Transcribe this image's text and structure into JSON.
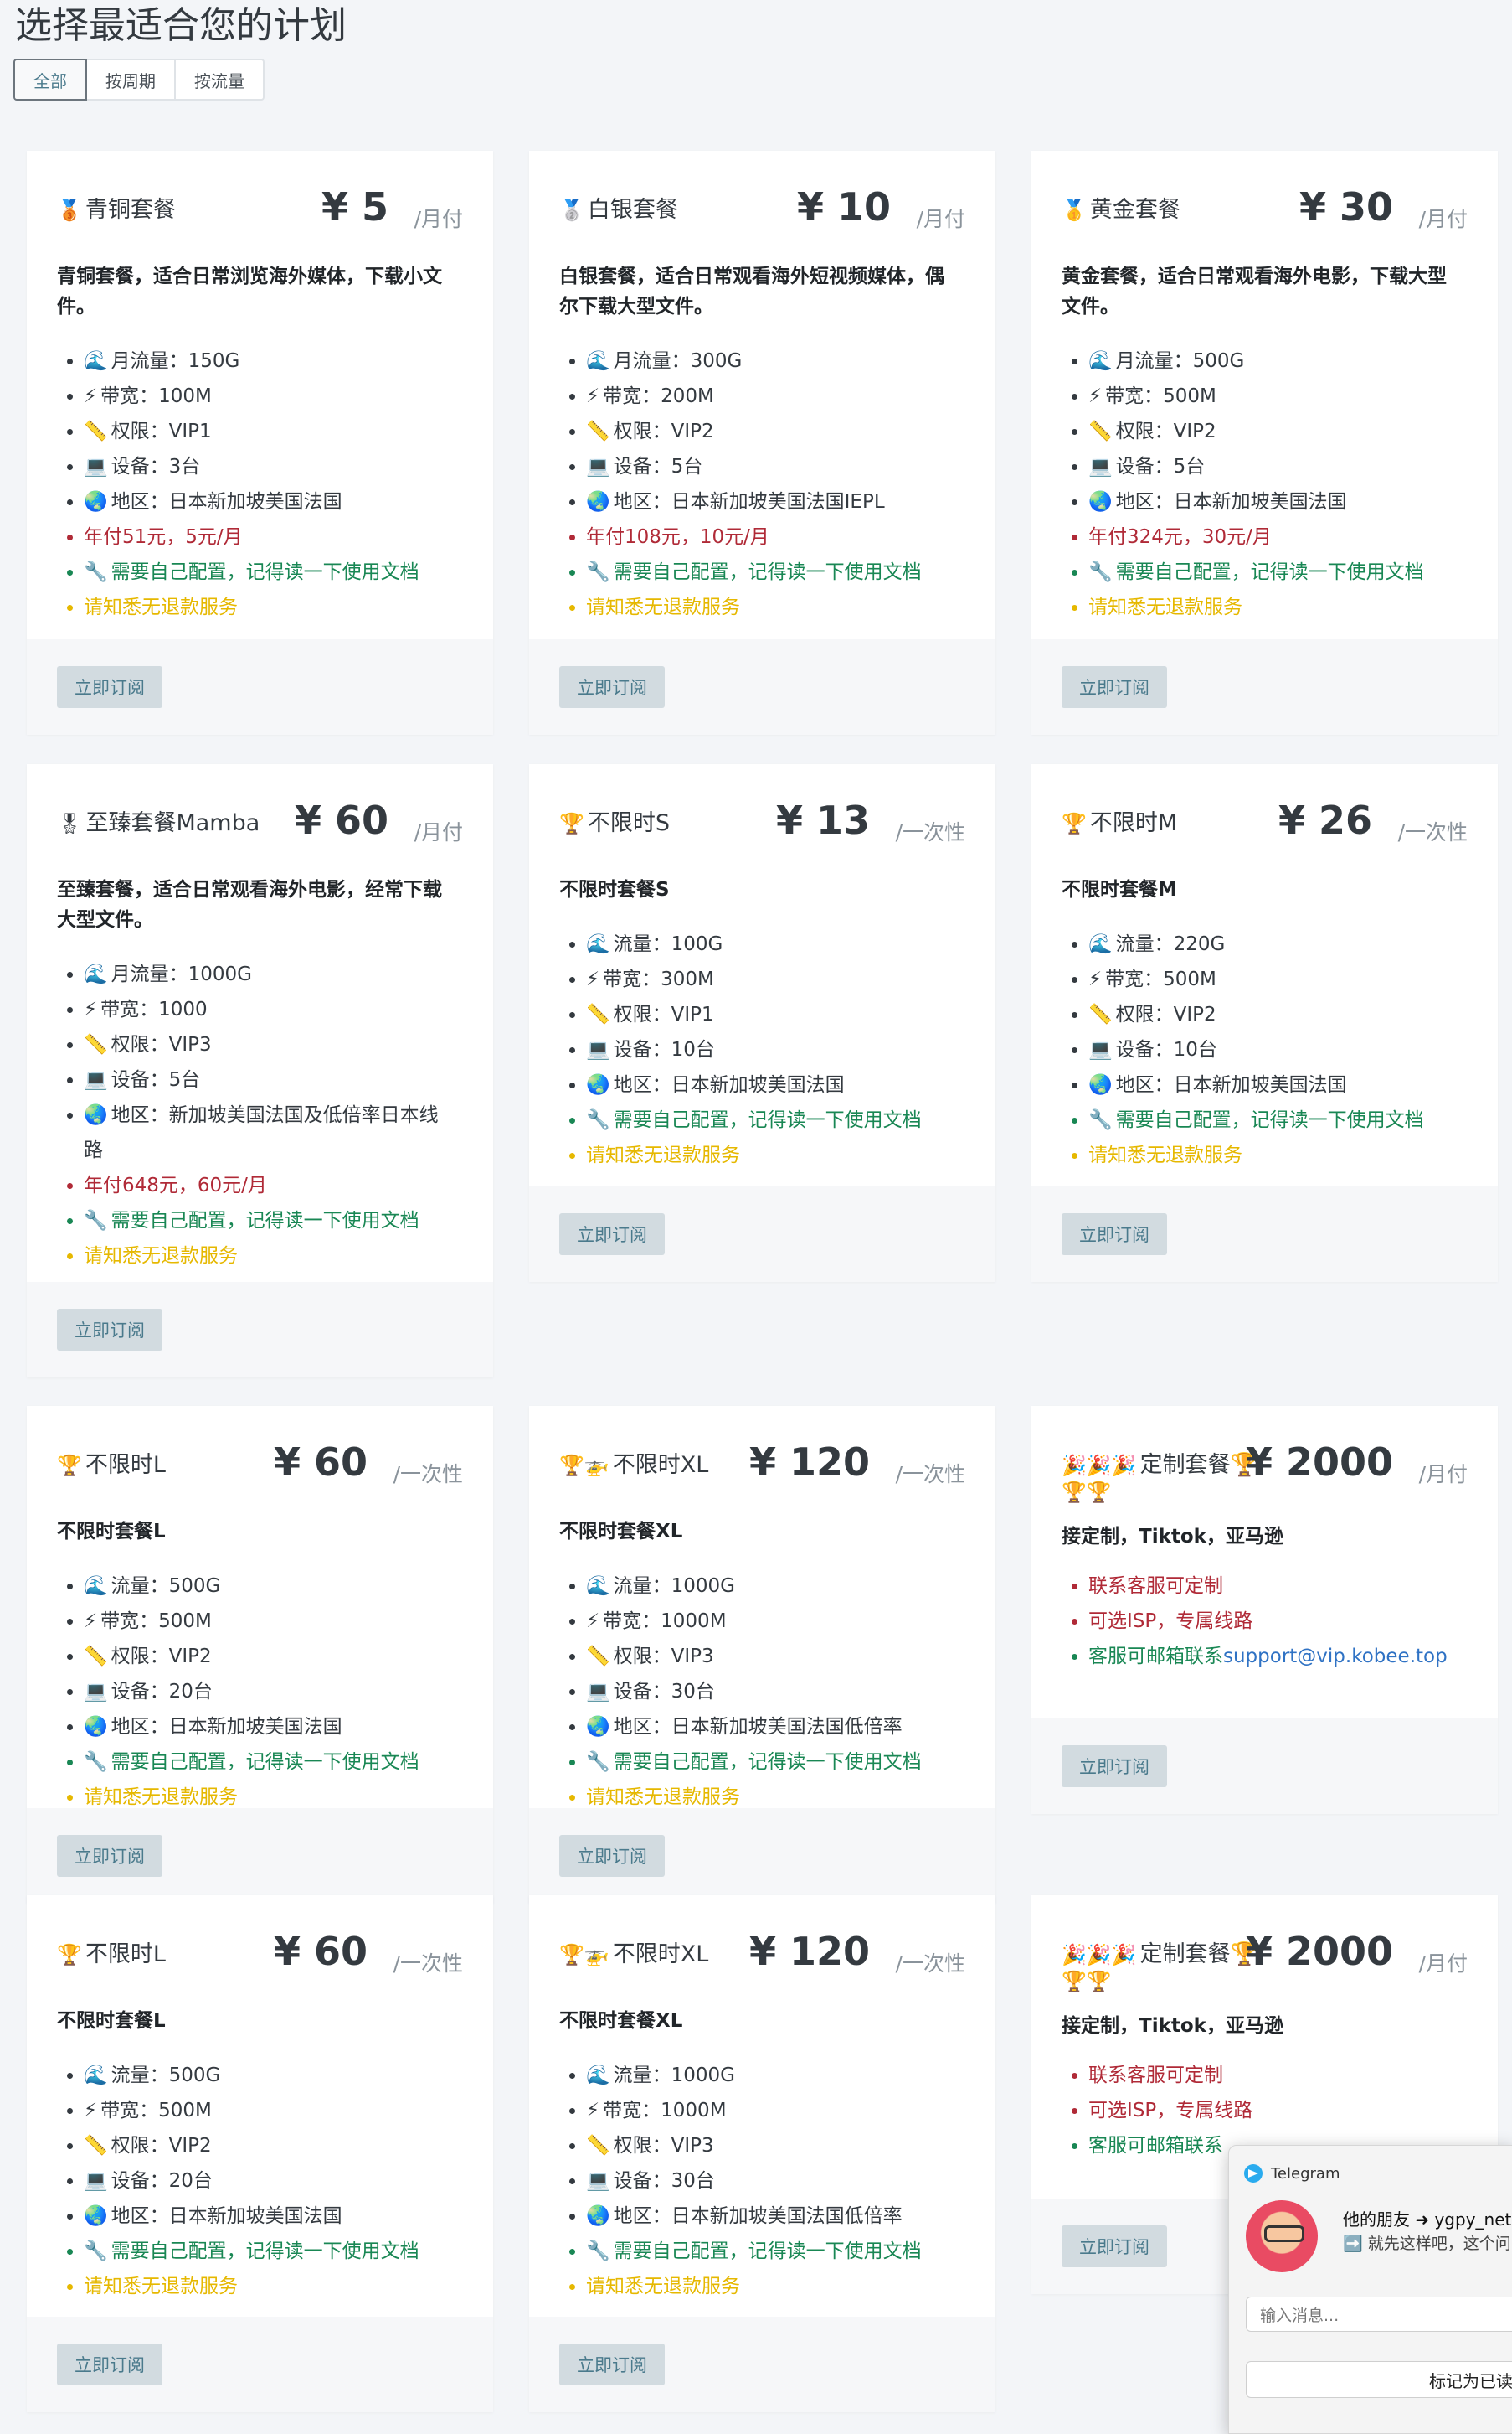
{
  "page": {
    "title": "选择最适合您的计划"
  },
  "filters": [
    {
      "label": "全部",
      "active": true
    },
    {
      "label": "按周期",
      "active": false
    },
    {
      "label": "按流量",
      "active": false
    }
  ],
  "subscribe_label": "立即订阅",
  "cards": [
    {
      "medal": "🥉",
      "name": "青铜套餐",
      "price": "¥ 5",
      "period": "/月付",
      "desc": [
        "青铜套餐，适合日常浏览海外媒体，下载小文",
        "件。"
      ],
      "features": [
        {
          "icon": "🌊",
          "text": "月流量：150G",
          "color": "default"
        },
        {
          "icon": "⚡",
          "text": "带宽：100M",
          "color": "default"
        },
        {
          "icon": "📏",
          "text": "权限：VIP1",
          "color": "default"
        },
        {
          "icon": "💻",
          "text": "设备：3台",
          "color": "default"
        },
        {
          "icon": "🌏",
          "text": "地区：日本新加坡美国法国",
          "color": "default"
        },
        {
          "icon": "",
          "text": "年付51元，5元/月",
          "color": "red"
        },
        {
          "icon": "🔧",
          "text": "需要自己配置，记得读一下使用文档",
          "color": "green"
        },
        {
          "icon": "",
          "text": "请知悉无退款服务",
          "color": "yellow"
        }
      ]
    },
    {
      "medal": "🥈",
      "name": "白银套餐",
      "price": "¥ 10",
      "period": "/月付",
      "desc": [
        "白银套餐，适合日常观看海外短视频媒体，偶",
        "尔下载大型文件。"
      ],
      "features": [
        {
          "icon": "🌊",
          "text": "月流量：300G",
          "color": "default"
        },
        {
          "icon": "⚡",
          "text": "带宽：200M",
          "color": "default"
        },
        {
          "icon": "📏",
          "text": "权限：VIP2",
          "color": "default"
        },
        {
          "icon": "💻",
          "text": "设备：5台",
          "color": "default"
        },
        {
          "icon": "🌏",
          "text": "地区：日本新加坡美国法国IEPL",
          "color": "default"
        },
        {
          "icon": "",
          "text": "年付108元，10元/月",
          "color": "red"
        },
        {
          "icon": "🔧",
          "text": "需要自己配置，记得读一下使用文档",
          "color": "green"
        },
        {
          "icon": "",
          "text": "请知悉无退款服务",
          "color": "yellow"
        }
      ]
    },
    {
      "medal": "🥇",
      "name": "黄金套餐",
      "price": "¥ 30",
      "period": "/月付",
      "desc": [
        "黄金套餐，适合日常观看海外电影，下载大型",
        "文件。"
      ],
      "features": [
        {
          "icon": "🌊",
          "text": "月流量：500G",
          "color": "default"
        },
        {
          "icon": "⚡",
          "text": "带宽：500M",
          "color": "default"
        },
        {
          "icon": "📏",
          "text": "权限：VIP2",
          "color": "default"
        },
        {
          "icon": "💻",
          "text": "设备：5台",
          "color": "default"
        },
        {
          "icon": "🌏",
          "text": "地区：日本新加坡美国法国",
          "color": "default"
        },
        {
          "icon": "",
          "text": "年付324元，30元/月",
          "color": "red"
        },
        {
          "icon": "🔧",
          "text": "需要自己配置，记得读一下使用文档",
          "color": "green"
        },
        {
          "icon": "",
          "text": "请知悉无退款服务",
          "color": "yellow"
        }
      ]
    },
    {
      "medal": "🎖",
      "name": "至臻套餐Mamba",
      "price": "¥ 60",
      "period": "/月付",
      "desc": [
        "至臻套餐，适合日常观看海外电影，经常下载",
        "大型文件。"
      ],
      "features": [
        {
          "icon": "🌊",
          "text": "月流量：1000G",
          "color": "default"
        },
        {
          "icon": "⚡",
          "text": "带宽：1000",
          "color": "default"
        },
        {
          "icon": "📏",
          "text": "权限：VIP3",
          "color": "default"
        },
        {
          "icon": "💻",
          "text": "设备：5台",
          "color": "default"
        },
        {
          "icon": "🌏",
          "text": "地区：新加坡美国法国及低倍率日本线",
          "text2": "路",
          "color": "default"
        },
        {
          "icon": "",
          "text": "年付648元，60元/月",
          "color": "red"
        },
        {
          "icon": "🔧",
          "text": "需要自己配置，记得读一下使用文档",
          "color": "green"
        },
        {
          "icon": "",
          "text": "请知悉无退款服务",
          "color": "yellow"
        }
      ]
    },
    {
      "medal": "🏆",
      "name": "不限时S",
      "price": "¥ 13",
      "period": "/一次性",
      "desc": [
        "不限时套餐S"
      ],
      "features": [
        {
          "icon": "🌊",
          "text": "流量：100G",
          "color": "default"
        },
        {
          "icon": "⚡",
          "text": "带宽：300M",
          "color": "default"
        },
        {
          "icon": "📏",
          "text": "权限：VIP1",
          "color": "default"
        },
        {
          "icon": "💻",
          "text": "设备：10台",
          "color": "default"
        },
        {
          "icon": "🌏",
          "text": "地区：日本新加坡美国法国",
          "color": "default"
        },
        {
          "icon": "🔧",
          "text": "需要自己配置，记得读一下使用文档",
          "color": "green"
        },
        {
          "icon": "",
          "text": "请知悉无退款服务",
          "color": "yellow"
        }
      ]
    },
    {
      "medal": "🏆",
      "name": "不限时M",
      "price": "¥ 26",
      "period": "/一次性",
      "desc": [
        "不限时套餐M"
      ],
      "features": [
        {
          "icon": "🌊",
          "text": "流量：220G",
          "color": "default"
        },
        {
          "icon": "⚡",
          "text": "带宽：500M",
          "color": "default"
        },
        {
          "icon": "📏",
          "text": "权限：VIP2",
          "color": "default"
        },
        {
          "icon": "💻",
          "text": "设备：10台",
          "color": "default"
        },
        {
          "icon": "🌏",
          "text": "地区：日本新加坡美国法国",
          "color": "default"
        },
        {
          "icon": "🔧",
          "text": "需要自己配置，记得读一下使用文档",
          "color": "green"
        },
        {
          "icon": "",
          "text": "请知悉无退款服务",
          "color": "yellow"
        }
      ]
    },
    {
      "medal": "🏆",
      "name": "不限时L",
      "price": "¥ 60",
      "period": "/一次性",
      "desc": [
        "不限时套餐L"
      ],
      "features": [
        {
          "icon": "🌊",
          "text": "流量：500G",
          "color": "default"
        },
        {
          "icon": "⚡",
          "text": "带宽：500M",
          "color": "default"
        },
        {
          "icon": "📏",
          "text": "权限：VIP2",
          "color": "default"
        },
        {
          "icon": "💻",
          "text": "设备：20台",
          "color": "default"
        },
        {
          "icon": "🌏",
          "text": "地区：日本新加坡美国法国",
          "color": "default"
        },
        {
          "icon": "🔧",
          "text": "需要自己配置，记得读一下使用文档",
          "color": "green"
        },
        {
          "icon": "",
          "text": "请知悉无退款服务",
          "color": "yellow"
        }
      ]
    },
    {
      "medal": "🏆🚁",
      "name": "不限时XL",
      "price": "¥ 120",
      "period": "/一次性",
      "desc": [
        "不限时套餐XL"
      ],
      "features": [
        {
          "icon": "🌊",
          "text": "流量：1000G",
          "color": "default"
        },
        {
          "icon": "⚡",
          "text": "带宽：1000M",
          "color": "default"
        },
        {
          "icon": "📏",
          "text": "权限：VIP3",
          "color": "default"
        },
        {
          "icon": "💻",
          "text": "设备：30台",
          "color": "default"
        },
        {
          "icon": "🌏",
          "text": "地区：日本新加坡美国法国低倍率",
          "color": "default"
        },
        {
          "icon": "🔧",
          "text": "需要自己配置，记得读一下使用文档",
          "color": "green"
        },
        {
          "icon": "",
          "text": "请知悉无退款服务",
          "color": "yellow"
        }
      ]
    },
    {
      "medal": "🎉🎉🎉",
      "name": "定制套餐🏆",
      "name2": "🏆🏆",
      "price": "¥ 2000",
      "period": "/月付",
      "desc": [
        "接定制，Tiktok，亚马逊"
      ],
      "features": [
        {
          "icon": "",
          "text": "联系客服可定制",
          "color": "red"
        },
        {
          "icon": "",
          "text": "可选ISP，专属线路",
          "color": "red"
        },
        {
          "icon": "",
          "text": "客服可邮箱联系",
          "link": "support@vip.kobee.top",
          "color": "green"
        }
      ]
    },
    {
      "medal": "🏆",
      "name": "不限时L",
      "price": "¥ 60",
      "period": "/一次性",
      "desc": [
        "不限时套餐L"
      ],
      "features": [
        {
          "icon": "🌊",
          "text": "流量：500G",
          "color": "default"
        },
        {
          "icon": "⚡",
          "text": "带宽：500M",
          "color": "default"
        },
        {
          "icon": "📏",
          "text": "权限：VIP2",
          "color": "default"
        },
        {
          "icon": "💻",
          "text": "设备：20台",
          "color": "default"
        },
        {
          "icon": "🌏",
          "text": "地区：日本新加坡美国法国",
          "color": "default"
        },
        {
          "icon": "🔧",
          "text": "需要自己配置，记得读一下使用文档",
          "color": "green"
        },
        {
          "icon": "",
          "text": "请知悉无退款服务",
          "color": "yellow"
        }
      ]
    },
    {
      "medal": "🏆🚁",
      "name": "不限时XL",
      "price": "¥ 120",
      "period": "/一次性",
      "desc": [
        "不限时套餐XL"
      ],
      "features": [
        {
          "icon": "🌊",
          "text": "流量：1000G",
          "color": "default"
        },
        {
          "icon": "⚡",
          "text": "带宽：1000M",
          "color": "default"
        },
        {
          "icon": "📏",
          "text": "权限：VIP3",
          "color": "default"
        },
        {
          "icon": "💻",
          "text": "设备：30台",
          "color": "default"
        },
        {
          "icon": "🌏",
          "text": "地区：日本新加坡美国法国低倍率",
          "color": "default"
        },
        {
          "icon": "🔧",
          "text": "需要自己配置，记得读一下使用文档",
          "color": "green"
        },
        {
          "icon": "",
          "text": "请知悉无退款服务",
          "color": "yellow"
        }
      ]
    },
    {
      "medal": "🎉🎉🎉",
      "name": "定制套餐🏆",
      "name2": "🏆🏆",
      "price": "¥ 2000",
      "period": "/月付",
      "desc": [
        "接定制，Tiktok，亚马逊"
      ],
      "features": [
        {
          "icon": "",
          "text": "联系客服可定制",
          "color": "red"
        },
        {
          "icon": "",
          "text": "可选ISP，专属线路",
          "color": "red"
        },
        {
          "icon": "",
          "text": "客服可邮箱联系",
          "color": "green"
        }
      ]
    }
  ],
  "telegram": {
    "app": "Telegram",
    "from": "他的朋友 ➜ ygpy_net",
    "message": "➡️ 就先这样吧，这个问",
    "input_placeholder": "输入消息...",
    "mark_read": "标记为已读"
  }
}
